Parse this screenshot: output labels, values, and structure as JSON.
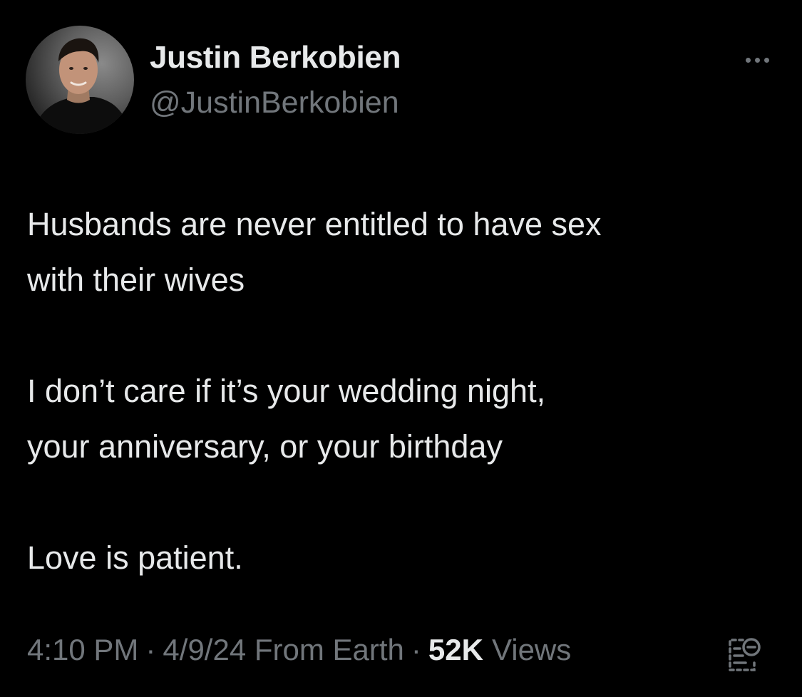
{
  "author": {
    "display_name": "Justin Berkobien",
    "handle": "@JustinBerkobien",
    "avatar_icon": "profile-photo"
  },
  "tweet": {
    "paragraphs": [
      [
        "Husbands are never entitled to have sex",
        "with their wives"
      ],
      [
        "I don’t care if it’s your wedding night,",
        "your anniversary, or your birthday"
      ],
      [
        "Love is patient."
      ]
    ]
  },
  "meta": {
    "time": "4:10 PM",
    "separator": "·",
    "date": "4/9/24",
    "source": "From Earth",
    "views_count": "52K",
    "views_label": "Views"
  },
  "icons": {
    "more": "more-horizontal-icon",
    "analytics": "post-analytics-icon"
  },
  "colors": {
    "background": "#000000",
    "primary_text": "#e7e9ea",
    "secondary_text": "#71767b"
  }
}
